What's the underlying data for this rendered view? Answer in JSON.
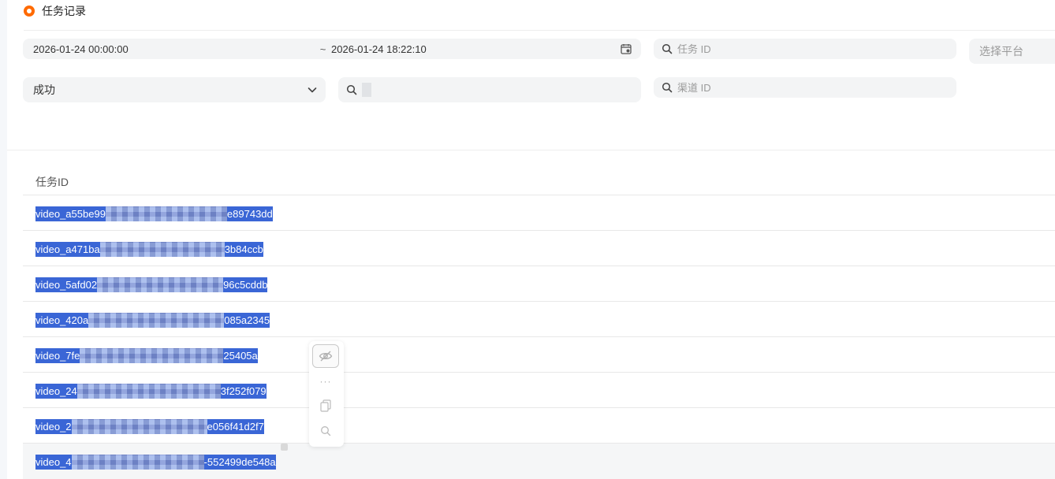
{
  "header": {
    "title": "任务记录",
    "accent_color": "#ff6a00"
  },
  "filters": {
    "date_start": "2026-01-24 00:00:00",
    "date_separator": "~",
    "date_end": "2026-01-24 18:22:10",
    "task_id_placeholder": "任务 ID",
    "platform_placeholder": "选择平台",
    "status_value": "成功",
    "channel_placeholder": "渠道 ID"
  },
  "table": {
    "column_header": "任务ID",
    "selection_color": "#3a66d6",
    "rows": [
      {
        "prefix": "video_a55be99",
        "suffix": "e89743dd"
      },
      {
        "prefix": "video_a471ba",
        "suffix": "3b84ccb"
      },
      {
        "prefix": "video_5afd02",
        "suffix": "96c5cddb"
      },
      {
        "prefix": "video_420a",
        "suffix": "085a2345"
      },
      {
        "prefix": "video_7fe",
        "suffix": "25405a"
      },
      {
        "prefix": "video_24",
        "suffix": "3f252f079"
      },
      {
        "prefix": "video_2",
        "suffix": "e056f41d2f7"
      },
      {
        "prefix": "video_4",
        "suffix": "-552499de548a"
      }
    ]
  },
  "toolbar": {
    "icons": [
      "eye-off-icon",
      "more-dots-icon",
      "copy-icon",
      "search-icon"
    ],
    "more_label": "···"
  }
}
